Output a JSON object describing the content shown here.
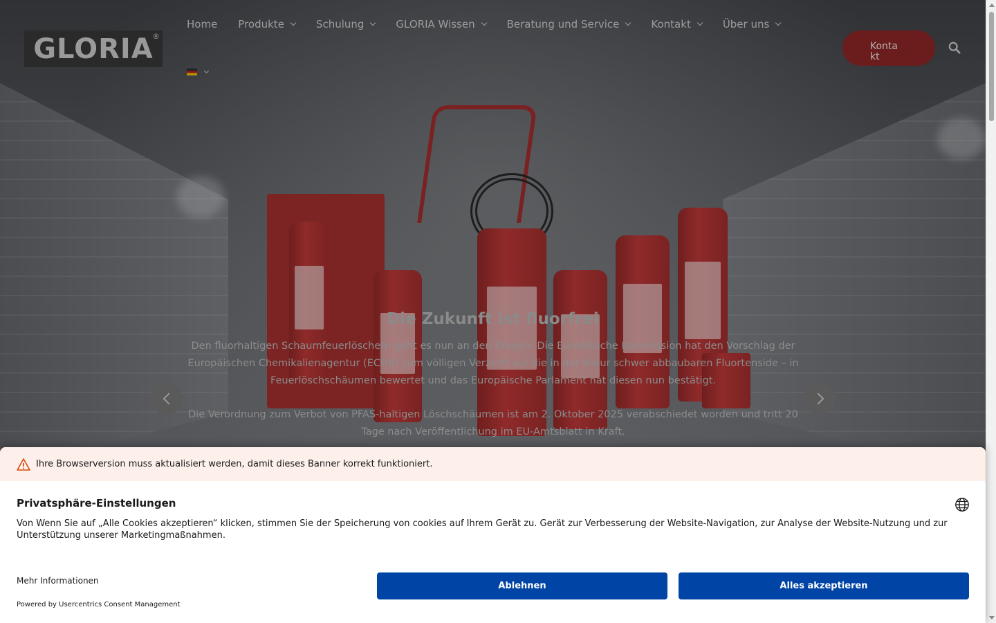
{
  "header": {
    "logo_text": "GLORIA",
    "logo_mark": "®",
    "nav": [
      {
        "label": "Home",
        "has_dropdown": false
      },
      {
        "label": "Produkte",
        "has_dropdown": true
      },
      {
        "label": "Schulung",
        "has_dropdown": true
      },
      {
        "label": "GLORIA Wissen",
        "has_dropdown": true
      },
      {
        "label": "Beratung und Service",
        "has_dropdown": true
      },
      {
        "label": "Kontakt",
        "has_dropdown": true
      },
      {
        "label": "Über uns",
        "has_dropdown": true
      }
    ],
    "language_flag": "de-flag-icon",
    "contact_button": "Konta\nkt",
    "search_icon": "search-icon"
  },
  "slide": {
    "title": "Die Zukunft ist fluorfrei",
    "paragraph1": "Den fluorhaltigen Schaumfeuerlöschern geht es nun an den Kragen: Die Europäische Kommission hat den Vorschlag der Europäischen Chemikalienagentur (ECHA) zum völligen Verzicht auf die in der Natur schwer abbaubaren Fluortenside – in Feuerlöschschäumen bewertet und das Europäische Parlament hat diesen nun bestätigt.",
    "paragraph2": "Die Verordnung zum Verbot von PFAS-haltigen Löschschäumen ist am 2. Oktober 2025 verabschiedet worden und tritt 20 Tage nach Veröffentlichung im EU-Amtsblatt in Kraft.",
    "prev_icon": "chevron-left-icon",
    "next_icon": "chevron-right-icon"
  },
  "consent": {
    "warning": "Ihre Browserversion muss aktualisiert werden, damit dieses Banner korrekt funktioniert.",
    "title": "Privatsphäre-Einstellungen",
    "description": "Von Wenn Sie auf „Alle Cookies akzeptieren“ klicken, stimmen Sie der Speicherung von cookies auf Ihrem Gerät zu. Gerät zur Verbesserung der Website-Navigation, zur Analyse der Website-Nutzung und zur Unterstützung unserer Marketingmaßnahmen.",
    "more_info": "Mehr Informationen",
    "powered_by": "Powered by Usercentrics Consent Management",
    "deny_label": "Ablehnen",
    "accept_label": "Alles akzeptieren",
    "button_color": "#0045a5",
    "warning_bg": "#fdf0ea"
  }
}
